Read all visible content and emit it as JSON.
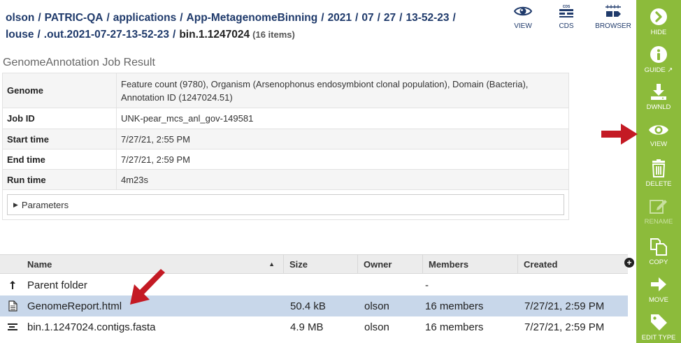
{
  "breadcrumb": {
    "parts": [
      "olson",
      "PATRIC-QA",
      "applications",
      "App-MetagenomeBinning",
      "2021",
      "07",
      "27",
      "13-52-23",
      "louse",
      ".out.2021-07-27-13-52-23"
    ],
    "current": "bin.1.1247024",
    "count": "(16 items)"
  },
  "top_actions": [
    {
      "label": "VIEW",
      "icon": "eye-icon"
    },
    {
      "label": "CDS",
      "icon": "cds-icon"
    },
    {
      "label": "BROWSER",
      "icon": "browser-icon"
    }
  ],
  "job": {
    "title": "GenomeAnnotation Job Result",
    "rows": [
      {
        "key": "Genome",
        "value": "Feature count (9780), Organism (Arsenophonus endosymbiont clonal population), Domain (Bacteria), Annotation ID (1247024.51)"
      },
      {
        "key": "Job ID",
        "value": "UNK-pear_mcs_anl_gov-149581"
      },
      {
        "key": "Start time",
        "value": "7/27/21, 2:55 PM"
      },
      {
        "key": "End time",
        "value": "7/27/21, 2:59 PM"
      },
      {
        "key": "Run time",
        "value": "4m23s"
      }
    ],
    "parameters_label": "Parameters"
  },
  "grid": {
    "columns": {
      "name": "Name",
      "size": "Size",
      "owner": "Owner",
      "members": "Members",
      "created": "Created"
    },
    "add_column_symbol": "+",
    "rows": [
      {
        "icon": "parent-folder-icon",
        "name": "Parent folder",
        "size": "",
        "owner": "",
        "members": "-",
        "created": ""
      },
      {
        "icon": "document-icon",
        "name": "GenomeReport.html",
        "size": "50.4 kB",
        "owner": "olson",
        "members": "16 members",
        "created": "7/27/21, 2:59 PM"
      },
      {
        "icon": "contigs-icon",
        "name": "bin.1.1247024.contigs.fasta",
        "size": "4.9 MB",
        "owner": "olson",
        "members": "16 members",
        "created": "7/27/21, 2:59 PM"
      }
    ]
  },
  "toolbar": [
    {
      "label": "HIDE",
      "icon": "hide-icon"
    },
    {
      "label": "GUIDE",
      "icon": "info-icon"
    },
    {
      "label": "DWNLD",
      "icon": "download-icon"
    },
    {
      "label": "VIEW",
      "icon": "eye-icon"
    },
    {
      "label": "DELETE",
      "icon": "trash-icon"
    },
    {
      "label": "RENAME",
      "icon": "pencil-icon"
    },
    {
      "label": "COPY",
      "icon": "copy-icon"
    },
    {
      "label": "MOVE",
      "icon": "arrow-right-icon"
    },
    {
      "label": "EDIT TYPE",
      "icon": "tag-icon"
    }
  ],
  "colors": {
    "toolbar_bg": "#8cbb3b",
    "breadcrumb_link": "#1f3a6b",
    "selected_row": "#c8d7ea",
    "annotation_arrow": "#c41a24"
  }
}
